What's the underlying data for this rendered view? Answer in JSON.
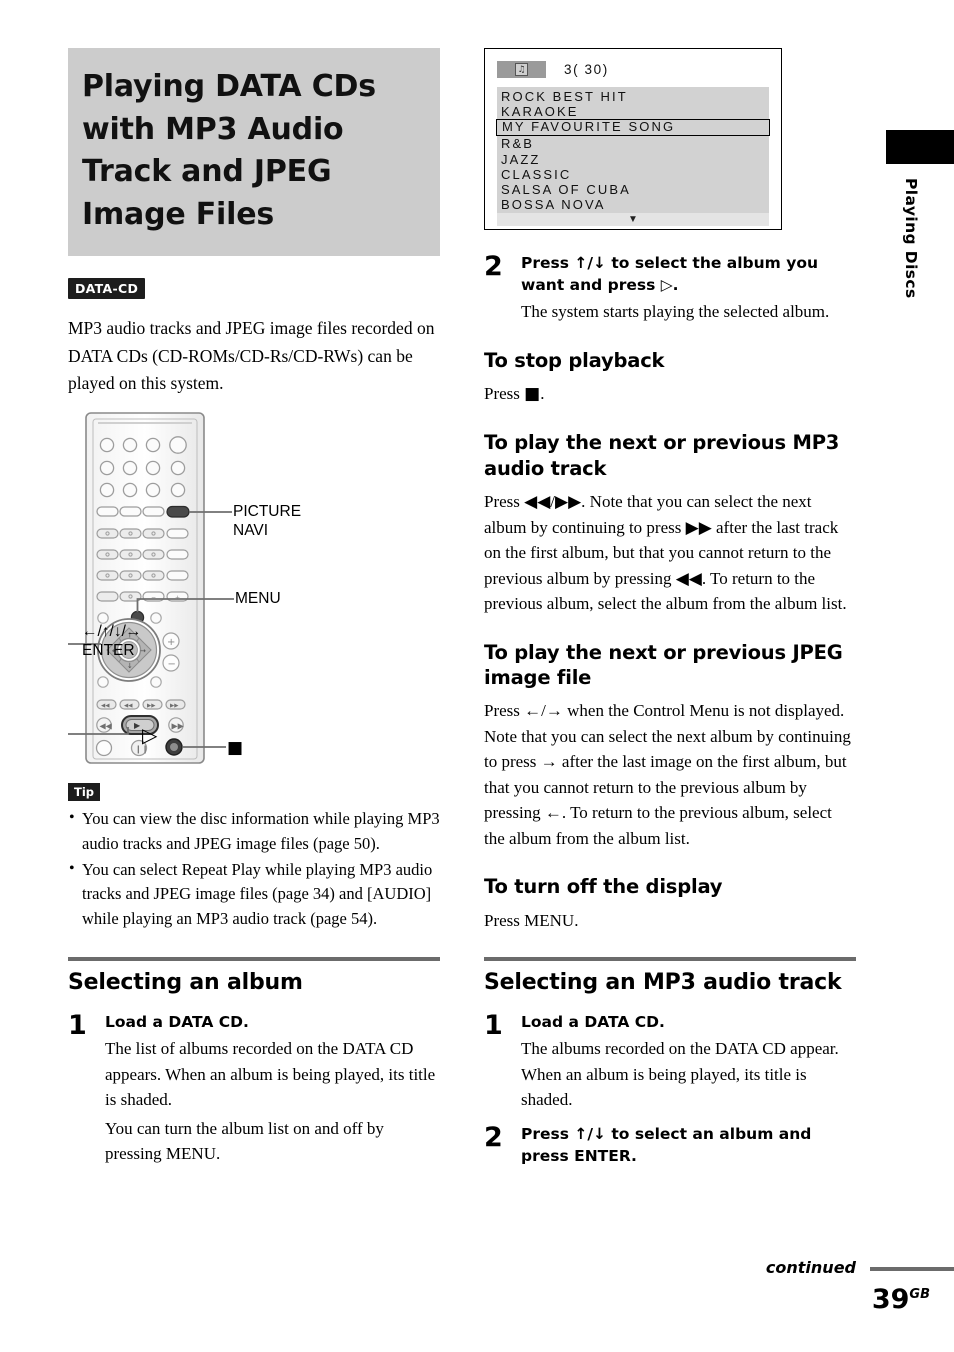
{
  "chapter": {
    "title": "Playing DATA CDs with MP3 Audio Track and JPEG Image Files",
    "disc_badge": "DATA-CD",
    "intro": "MP3 audio tracks and JPEG image files recorded on DATA CDs (CD-ROMs/CD-Rs/CD-RWs) can be played on this system."
  },
  "remote": {
    "callouts": {
      "picture_navi": "PICTURE\nNAVI",
      "menu": "MENU",
      "arrows_enter": "←/↑/↓/→\nENTER",
      "play": "▷",
      "stop": "■"
    }
  },
  "tip": {
    "badge": "Tip",
    "items": [
      "You can view the disc information while playing MP3 audio tracks and JPEG image files (page 50).",
      "You can select Repeat Play while playing MP3 audio tracks and JPEG image files (page 34) and [AUDIO] while playing an MP3 audio track (page 54)."
    ]
  },
  "selecting_album": {
    "heading": "Selecting an album",
    "step1": {
      "num": "1",
      "lead": "Load a DATA CD.",
      "desc1": "The list of albums recorded on the DATA CD appears. When an album is being played, its title is shaded.",
      "desc2": "You can turn the album list on and off by pressing MENU."
    },
    "step2": {
      "num": "2",
      "lead": "Press ↑/↓ to select the album you want and press ▷.",
      "desc": "The system starts playing the selected album."
    }
  },
  "tv_screen": {
    "icon": "album-icon",
    "counter": "3( 30)",
    "albums": [
      {
        "label": "ROCK BEST HIT",
        "selected": false
      },
      {
        "label": "KARAOKE",
        "selected": false
      },
      {
        "label": "MY FAVOURITE SONG",
        "selected": true
      },
      {
        "label": "R&B",
        "selected": false
      },
      {
        "label": "JAZZ",
        "selected": false
      },
      {
        "label": "CLASSIC",
        "selected": false
      },
      {
        "label": "SALSA OF CUBA",
        "selected": false
      },
      {
        "label": "BOSSA NOVA",
        "selected": false
      }
    ],
    "scroll_down": "▼"
  },
  "subsections": {
    "stop_playback": {
      "heading": "To stop playback",
      "body_pre": "Press ",
      "body_glyph": "■",
      "body_post": "."
    },
    "next_prev_mp3": {
      "heading": "To play the next or previous MP3 audio track",
      "body": "Press ◀◀/▶▶. Note that you can select the next album by continuing to press ▶▶ after the last track on the first album, but that you cannot return to the previous album by pressing ◀◀. To return to the previous album, select the album from the album list."
    },
    "next_prev_jpeg": {
      "heading": "To play the next or previous JPEG image file",
      "body": "Press ←/→ when the Control Menu is not displayed. Note that you can select the next album by continuing to press → after the last image on the first album, but that you cannot return to the previous album by pressing ←. To return to the previous album, select the album from the album list."
    },
    "turn_off_display": {
      "heading": "To turn off the display",
      "body": "Press MENU."
    }
  },
  "selecting_mp3": {
    "heading": "Selecting an MP3 audio track",
    "step1": {
      "num": "1",
      "lead": "Load a DATA CD.",
      "desc": "The albums recorded on the DATA CD appear. When an album is being played, its title is shaded."
    },
    "step2": {
      "num": "2",
      "lead": "Press ↑/↓ to select an album and press ENTER."
    }
  },
  "side_tab": {
    "label": "Playing Discs"
  },
  "footer": {
    "continued": "continued",
    "page": "39",
    "page_suffix": "GB"
  }
}
